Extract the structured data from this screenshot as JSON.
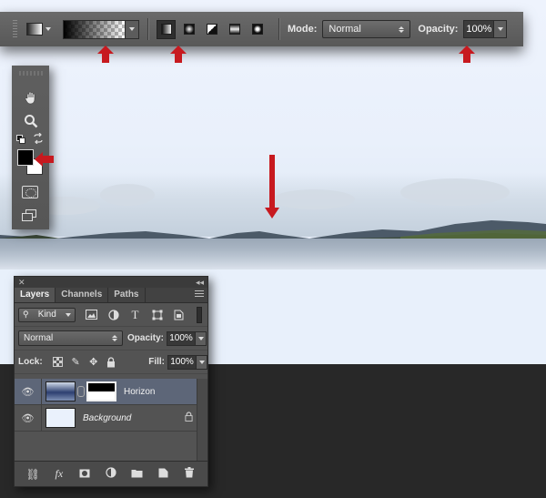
{
  "options_bar": {
    "mode_label": "Mode:",
    "mode_value": "Normal",
    "opacity_label": "Opacity:",
    "opacity_value": "100%",
    "gradient_types": [
      "linear",
      "radial",
      "angle",
      "reflected",
      "diamond"
    ],
    "active_gradient_type": "linear"
  },
  "toolbox": {
    "tools": [
      "hand-tool",
      "zoom-tool",
      "default-colors",
      "swap-colors",
      "foreground-color",
      "background-color",
      "quick-mask",
      "screen-mode"
    ],
    "foreground_color": "#000000",
    "background_color": "#ffffff"
  },
  "layers_panel": {
    "tabs": [
      "Layers",
      "Channels",
      "Paths"
    ],
    "active_tab": "Layers",
    "filter_kind": "Kind",
    "blend_mode": "Normal",
    "opacity_label": "Opacity:",
    "opacity_value": "100%",
    "lock_label": "Lock:",
    "fill_label": "Fill:",
    "fill_value": "100%",
    "layers": [
      {
        "name": "Horizon",
        "selected": true,
        "has_mask": true
      },
      {
        "name": "Background",
        "selected": false,
        "locked": true
      }
    ],
    "footer_icons": [
      "link-icon",
      "fx-icon",
      "add-mask-icon",
      "adjustment-icon",
      "folder-icon",
      "new-layer-icon",
      "trash-icon"
    ]
  },
  "annotations": {
    "arrow_color": "#c7191f"
  }
}
